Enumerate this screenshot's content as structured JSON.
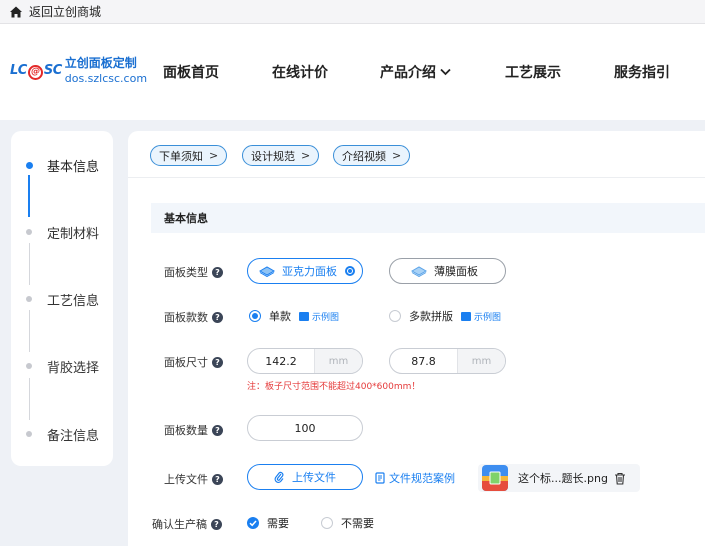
{
  "topbar": {
    "back_label": "返回立创商城"
  },
  "logo": {
    "mark_left": "LC",
    "mark_at": "@",
    "mark_right": "SC",
    "title": "立创面板定制",
    "url": "dos.szlcsc.com"
  },
  "nav": {
    "items": [
      "面板首页",
      "在线计价",
      "产品介绍",
      "工艺展示",
      "服务指引"
    ]
  },
  "steps": [
    "基本信息",
    "定制材料",
    "工艺信息",
    "背胶选择",
    "备注信息"
  ],
  "pills": [
    "下单须知",
    "设计规范",
    "介绍视频"
  ],
  "section_title": "基本信息",
  "form": {
    "panel_type": {
      "label": "面板类型",
      "options": [
        "亚克力面板",
        "薄膜面板"
      ],
      "selected": "亚克力面板"
    },
    "panel_style": {
      "label": "面板款数",
      "options": [
        "单款",
        "多款拼版"
      ],
      "selected": "单款",
      "example_label": "示例图"
    },
    "panel_size": {
      "label": "面板尺寸",
      "width": "142.2",
      "height": "87.8",
      "unit": "mm",
      "warning": "注：板子尺寸范围不能超过400*600mm！"
    },
    "panel_qty": {
      "label": "面板数量",
      "value": "100"
    },
    "upload": {
      "label": "上传文件",
      "button": "上传文件",
      "spec_link": "文件规范案例",
      "file_name": "这个标...题长.png"
    },
    "confirm": {
      "label": "确认生产稿",
      "options": [
        "需要",
        "不需要"
      ],
      "selected": "需要"
    }
  },
  "colors": {
    "accent": "#1a7ff0",
    "warning": "#e53a3a",
    "logo_blue": "#1a6fd1",
    "logo_red": "#e32929"
  }
}
